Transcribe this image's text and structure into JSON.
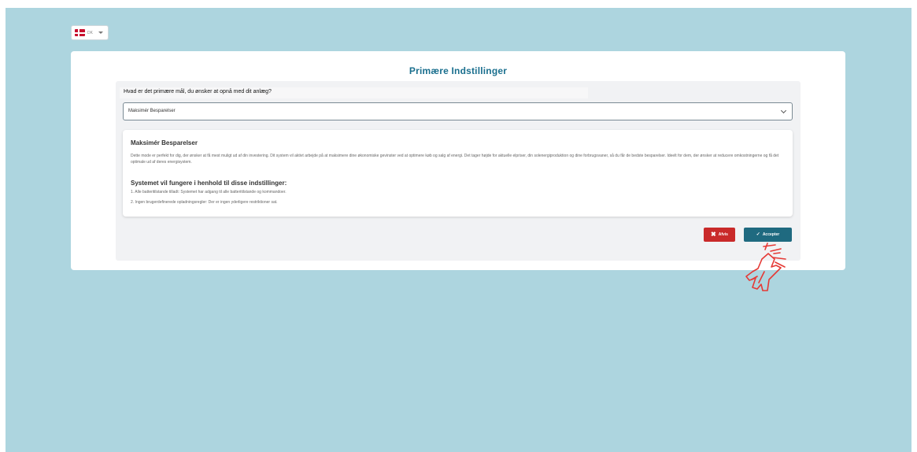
{
  "language": {
    "code": "DK",
    "flag_icon": "danish-flag-icon"
  },
  "card": {
    "title": "Primære Indstillinger"
  },
  "question": {
    "text": "Hvad er det primære mål, du ønsker at opnå med dit anlæg?"
  },
  "goal_select": {
    "value": "Maksimér Besparelser"
  },
  "description": {
    "heading": "Maksimér Besparelser",
    "text": "Dette mode er perfekt for dig, der ønsker at få mest muligt ud af din investering. Dit system vil aktivt arbejde på at maksimere dine økonomiske gevinster ved at optimere køb og salg af energi. Det tager højde for aktuelle elpriser, din solenergiproduktion og dine forbrugsvaner, så du får de bedste besparelser. Ideelt for dem, der ønsker at reducere omkostningerne og få det optimale ud af deres energisystem.",
    "settings_heading": "Systemet vil fungere i henhold til disse indstillinger:",
    "rules": [
      "1. Alle batteritilstande tilladt: Systemet har adgang til alle batteritilstande og kommandoer.",
      "2. Ingen brugerdefinerede opladningsregler: Der er ingen yderligere restriktioner sat."
    ]
  },
  "buttons": {
    "reject": "Afvis",
    "accept": "Accepter"
  },
  "colors": {
    "background": "#add5df",
    "title": "#1a6f8e",
    "reject": "#c92a2a",
    "accept": "#1f6a80",
    "cursor_annotation": "#e53935"
  }
}
